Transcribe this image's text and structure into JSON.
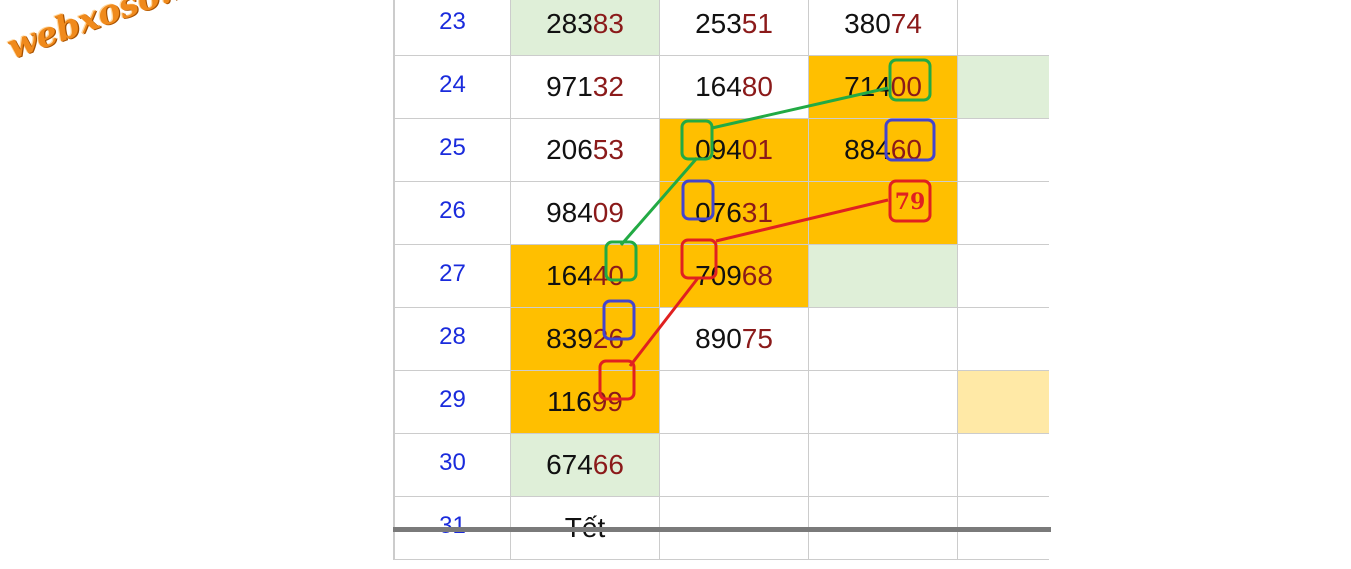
{
  "watermark": "webxoso.net",
  "rows": [
    {
      "day": "23",
      "cells": [
        {
          "head": "283",
          "tail": "83"
        },
        {
          "head": "253",
          "tail": "51"
        },
        {
          "head": "380",
          "tail": "74"
        }
      ]
    },
    {
      "day": "24",
      "cells": [
        {
          "head": "971",
          "tail": "32"
        },
        {
          "head": "164",
          "tail": "80"
        },
        {
          "head": "714",
          "tail": "00"
        }
      ]
    },
    {
      "day": "25",
      "cells": [
        {
          "head": "206",
          "tail": "53"
        },
        {
          "head": "094",
          "tail": "01"
        },
        {
          "head": "884",
          "tail": "60"
        }
      ]
    },
    {
      "day": "26",
      "cells": [
        {
          "head": "984",
          "tail": "09"
        },
        {
          "head": "076",
          "tail": "31"
        },
        {
          "head": "",
          "tail": ""
        }
      ]
    },
    {
      "day": "27",
      "cells": [
        {
          "head": "164",
          "tail": "40"
        },
        {
          "head": "709",
          "tail": "68"
        },
        {
          "head": "",
          "tail": ""
        }
      ]
    },
    {
      "day": "28",
      "cells": [
        {
          "head": "839",
          "tail": "26"
        },
        {
          "head": "890",
          "tail": "75"
        },
        {
          "head": "",
          "tail": ""
        }
      ]
    },
    {
      "day": "29",
      "cells": [
        {
          "head": "116",
          "tail": "99"
        },
        {
          "head": "",
          "tail": ""
        },
        {
          "head": "",
          "tail": ""
        }
      ]
    },
    {
      "day": "30",
      "cells": [
        {
          "head": "674",
          "tail": "66"
        },
        {
          "head": "",
          "tail": ""
        },
        {
          "head": "",
          "tail": ""
        }
      ]
    },
    {
      "day": "31",
      "cells": [
        {
          "head": "Tết",
          "tail": ""
        },
        {
          "head": "",
          "tail": ""
        },
        {
          "head": "",
          "tail": ""
        }
      ]
    }
  ],
  "prediction_label": "79",
  "colors": {
    "highlight": "#ffbf00",
    "light_green": "#dfefd8",
    "light_yellow": "#ffe9a6",
    "day_number": "#1a2bdc",
    "tail_digits": "#8b1a1a",
    "green_marker": "#22aa44",
    "blue_marker": "#4444cc",
    "red_marker": "#e02020"
  }
}
